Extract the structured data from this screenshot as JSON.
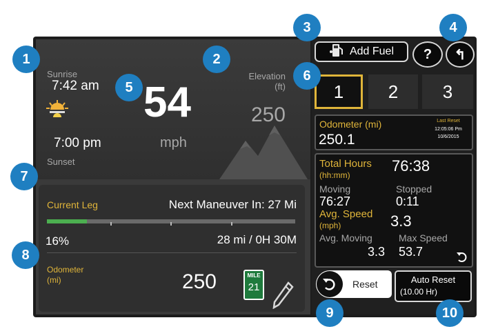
{
  "left": {
    "sunrise_label": "Sunrise",
    "sunrise_time": "7:42 am",
    "sunset_time": "7:00 pm",
    "sunset_label": "Sunset",
    "speed_value": "54",
    "speed_unit": "mph",
    "elevation_label": "Elevation",
    "elevation_unit": "(ft)",
    "elevation_value": "250"
  },
  "leg": {
    "current_leg_label": "Current Leg",
    "next_maneuver": "Next Maneuver In: 27 Mi",
    "progress_percent_text": "16%",
    "progress_fraction": 0.16,
    "distance_time": "28 mi / 0H 30M",
    "odometer_label_line1": "Odometer",
    "odometer_label_line2": "(mi)",
    "odometer_value": "250",
    "mile_sign_top": "MILE",
    "mile_sign_number": "21"
  },
  "right": {
    "add_fuel_label": "Add Fuel",
    "help_label": "?",
    "back_label": "↰",
    "tabs": [
      "1",
      "2",
      "3"
    ],
    "odometer_label": "Odometer (mi)",
    "odometer_value": "250.1",
    "last_reset_label": "Last Reset",
    "last_reset_time": "12:05:06 Pm",
    "last_reset_date": "10/6/2015",
    "total_hours_label": "Total Hours",
    "total_hours_unit": "(hh:mm)",
    "total_hours_value": "76:38",
    "moving_label": "Moving",
    "moving_value": "76:27",
    "stopped_label": "Stopped",
    "stopped_value": "0:11",
    "avg_speed_label": "Avg. Speed",
    "avg_speed_unit": "(mph)",
    "avg_speed_value": "3.3",
    "avg_moving_label": "Avg. Moving",
    "avg_moving_value": "3.3",
    "max_speed_label": "Max Speed",
    "max_speed_value": "53.7",
    "reset_label": "Reset",
    "auto_reset_label": "Auto Reset",
    "auto_reset_value": "(10.00 Hr)"
  },
  "callouts": [
    "1",
    "2",
    "3",
    "4",
    "5",
    "6",
    "7",
    "8",
    "9",
    "10"
  ],
  "colors": {
    "callout_blue": "#1f7fc1",
    "gold_label": "#e0b53a",
    "progress_green": "#4caf50",
    "sign_green": "#1e7a3c"
  }
}
